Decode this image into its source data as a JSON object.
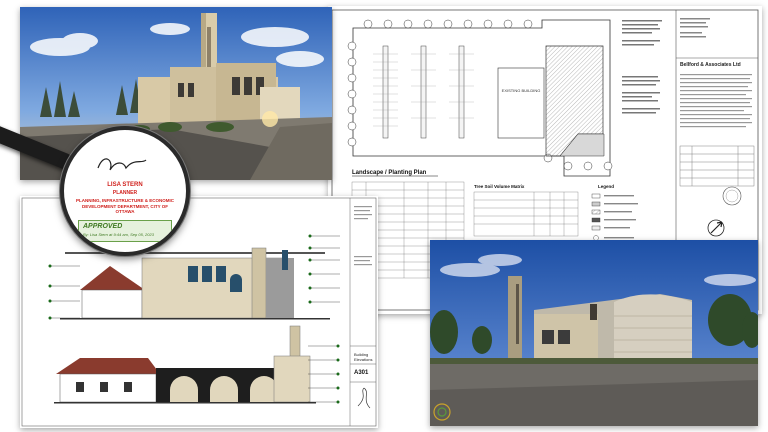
{
  "site_plan": {
    "title": "Landscape / Planting Plan",
    "soil_matrix_title": "Tree Soil Volume Matrix",
    "legend_title": "Legend",
    "existing_building_label": "EXISTING BUILDING",
    "firm_name": "Bellford & Associates Ltd"
  },
  "approval": {
    "name": "LISA STERN",
    "role": "PLANNER",
    "department": "PLANNING, INFRASTRUCTURE & ECONOMIC DEVELOPMENT DEPARTMENT, CITY OF OTTAWA",
    "stamp_title": "APPROVED",
    "stamp_line": "By: Lisa Stern at 9:44 am, Sep 05, 2023"
  },
  "elevations": {
    "sheet_number": "A301",
    "sheet_title": "Building Elevations"
  },
  "colors": {
    "approval_red": "#d0201c",
    "approval_green": "#3f7a22",
    "brick": "#b5553e",
    "stone": "#e1d7bd"
  }
}
